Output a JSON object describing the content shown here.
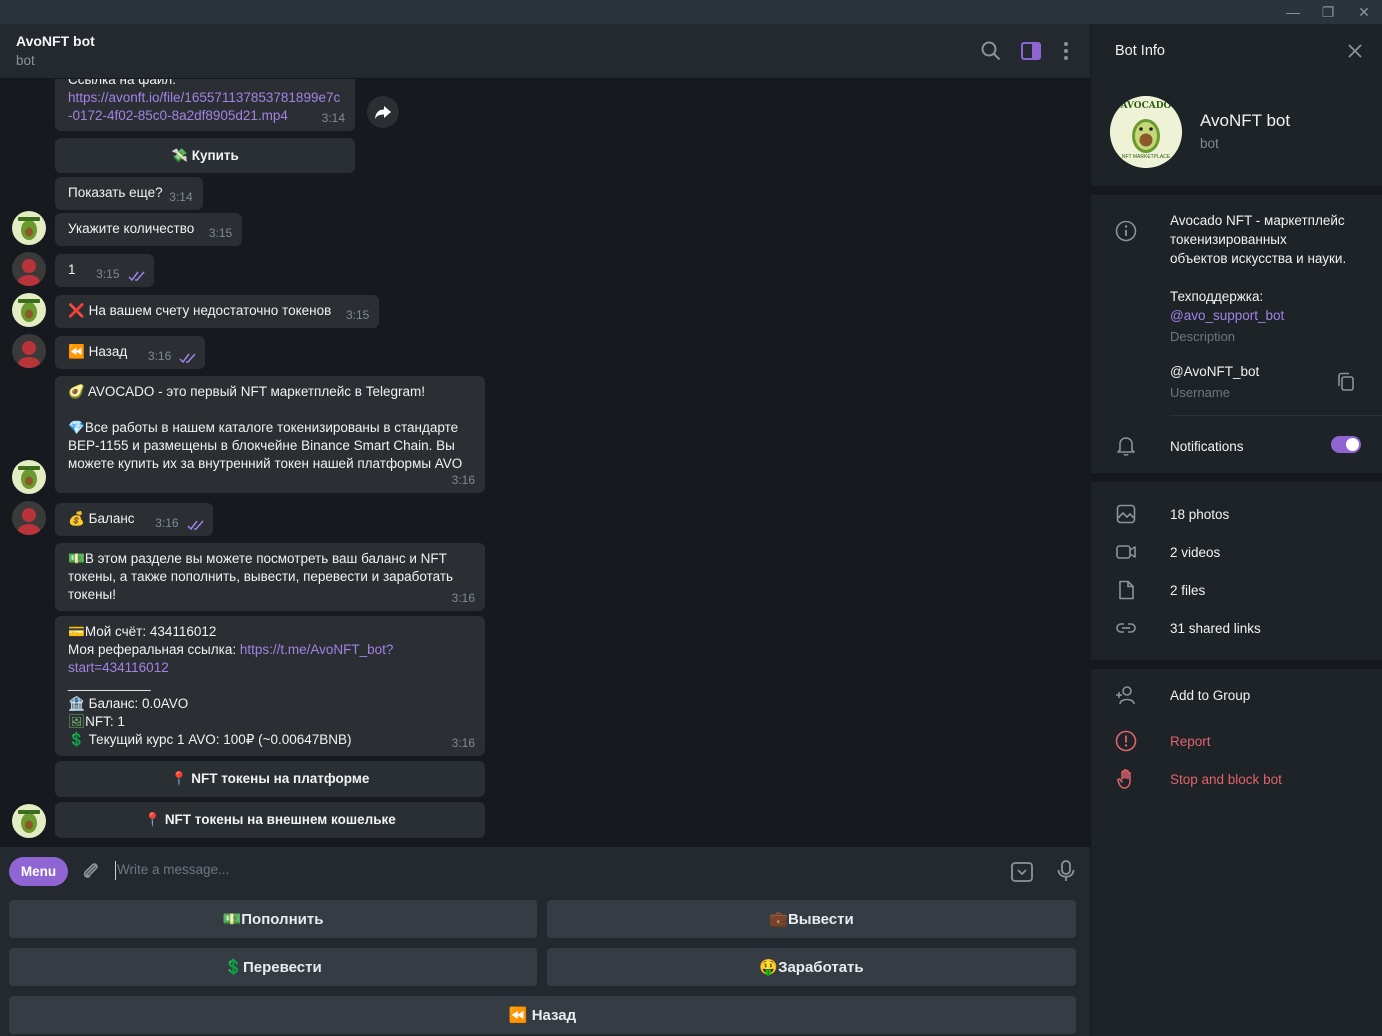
{
  "window": {
    "minimize": "—",
    "restore": "❐",
    "close": "✕"
  },
  "chat": {
    "title": "AvoNFT bot",
    "subtitle": "bot"
  },
  "messages": {
    "file": {
      "label": "Ссылка на файл:",
      "link_line1": "https://avonft.io/file/165571137853781899e7c",
      "link_line2": "-0172-4f02-85c0-8a2df8905d21.mp4",
      "time": "3:14"
    },
    "buy_button": "Купить",
    "show_more": {
      "text": "Показать еще?",
      "time": "3:14"
    },
    "enter_qty": {
      "text": "Укажите количество",
      "time": "3:15"
    },
    "user_1": {
      "text": "1",
      "time": "3:15"
    },
    "not_enough": {
      "text": "На вашем счету недостаточно токенов",
      "time": "3:15"
    },
    "user_back": {
      "text": "Назад",
      "time": "3:16"
    },
    "avocado_intro": {
      "line1": "AVOCADO - это первый NFT маркетплейс в Telegram!",
      "line2": "Все работы в нашем каталоге токенизированы в стандарте",
      "line3": "BEP-1155 и размещены в блокчейне Binance Smart Chain. Вы",
      "line4": "можете купить их за внутренний токен нашей платформы AVO",
      "time": "3:16"
    },
    "user_balance": {
      "text": "Баланс",
      "time": "3:16"
    },
    "balance_info": {
      "line1": "В этом разделе вы можете посмотреть ваш баланс и NFT",
      "line2": "токены, а также пополнить, вывести, перевести и заработать",
      "line3": "токены!",
      "time": "3:16"
    },
    "account": {
      "line1": "Мой счёт: 434116012",
      "ref_label": "Моя реферальная ссылка: ",
      "ref_link1": "https://t.me/AvoNFT_bot?",
      "ref_link2": "start=434116012",
      "divider": "___________",
      "balance": "Баланс: 0.0AVO",
      "nft": "NFT: 1",
      "rate": "Текущий курс 1 AVO: 100₽ (~0.00647BNB)",
      "time": "3:16"
    },
    "kb_platform": "NFT токены на платформе",
    "kb_external": "NFT токены на внешнем кошельке"
  },
  "composer": {
    "menu_label": "Menu",
    "placeholder": "Write a message..."
  },
  "bot_keyboard": {
    "deposit": "Пополнить",
    "withdraw": "Вывести",
    "transfer": "Перевести",
    "earn": "Заработать",
    "back": "Назад"
  },
  "emojis": {
    "buy": "💸",
    "cross": "❌",
    "back": "⏪",
    "avocado": "🥑",
    "gem": "💎",
    "bag": "💰",
    "money": "💵",
    "card": "💳",
    "bank": "🏦",
    "frame": "🖼",
    "dollar": "💲",
    "pin": "📍",
    "briefcase": "💼",
    "money_face": "🤑"
  },
  "panel": {
    "title": "Bot Info",
    "name": "AvoNFT bot",
    "subtitle": "bot",
    "description_line1": "Avocado NFT - маркетплейс",
    "description_line2": "токенизированных",
    "description_line3": "объектов искусства и науки.",
    "support_label": "Техподдержка:",
    "support_link": "@avo_support_bot",
    "description_caption": "Description",
    "username": "@AvoNFT_bot",
    "username_caption": "Username",
    "notifications": "Notifications",
    "notifications_on": true,
    "photos": "18 photos",
    "videos": "2 videos",
    "files": "2 files",
    "links": "31 shared links",
    "add_to_group": "Add to Group",
    "report": "Report",
    "stop_block": "Stop and block bot",
    "logo_text_top": "AVOCADO",
    "logo_text_bottom": "NFT MARKETPLACE"
  },
  "colors": {
    "accent": "#8e65d3",
    "link": "#a182e5",
    "danger": "#e0636b"
  }
}
